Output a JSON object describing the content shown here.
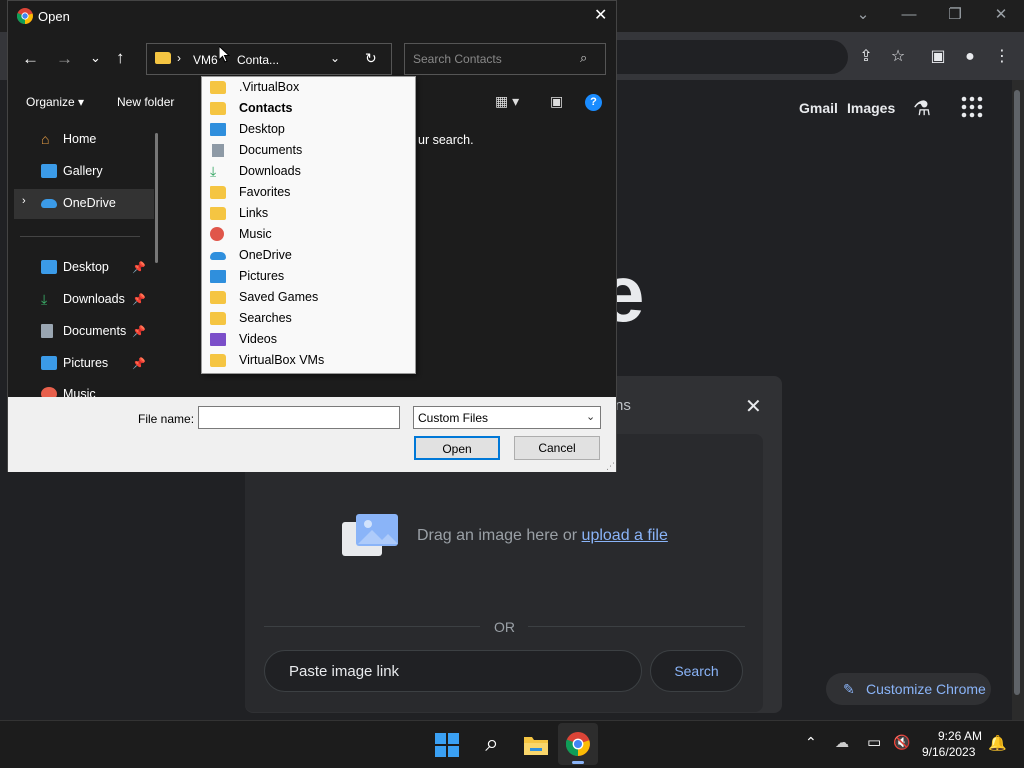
{
  "chrome": {
    "google_links": {
      "gmail": "Gmail",
      "images": "Images"
    },
    "logo_fragment": "e",
    "lens": {
      "title_fragment": "ns",
      "drop_text": "Drag an image here or",
      "upload_link": "upload a file",
      "or": "OR",
      "paste_placeholder": "Paste image link",
      "search_button": "Search"
    },
    "customize": "Customize Chrome"
  },
  "dialog": {
    "title": "Open",
    "address": {
      "root": "VM6",
      "current": "Conta..."
    },
    "search_placeholder": "Search Contacts",
    "commands": {
      "organize": "Organize",
      "new_folder": "New folder"
    },
    "empty_message_fragment": "ur search.",
    "nav": [
      {
        "label": "Home",
        "icon": "home-icon"
      },
      {
        "label": "Gallery",
        "icon": "gallery-icon"
      },
      {
        "label": "OneDrive",
        "icon": "onedrive-icon",
        "selected": true
      },
      {
        "label": "Desktop",
        "icon": "desktop-icon",
        "pinned": true
      },
      {
        "label": "Downloads",
        "icon": "downloads-icon",
        "pinned": true
      },
      {
        "label": "Documents",
        "icon": "documents-icon",
        "pinned": true
      },
      {
        "label": "Pictures",
        "icon": "pictures-icon",
        "pinned": true
      },
      {
        "label": "Music",
        "icon": "music-icon",
        "pinned": true
      }
    ],
    "file_name_label": "File name:",
    "file_name_value": "",
    "file_type": "Custom Files",
    "open_button": "Open",
    "cancel_button": "Cancel"
  },
  "dropdown": {
    "items": [
      {
        "label": ".VirtualBox",
        "icon": "folder-icon"
      },
      {
        "label": "Contacts",
        "icon": "folder-icon",
        "bold": true
      },
      {
        "label": "Desktop",
        "icon": "desktop-icon"
      },
      {
        "label": "Documents",
        "icon": "documents-icon"
      },
      {
        "label": "Downloads",
        "icon": "downloads-icon"
      },
      {
        "label": "Favorites",
        "icon": "folder-icon"
      },
      {
        "label": "Links",
        "icon": "folder-icon"
      },
      {
        "label": "Music",
        "icon": "music-icon"
      },
      {
        "label": "OneDrive",
        "icon": "onedrive-icon"
      },
      {
        "label": "Pictures",
        "icon": "pictures-icon"
      },
      {
        "label": "Saved Games",
        "icon": "folder-icon"
      },
      {
        "label": "Searches",
        "icon": "folder-icon"
      },
      {
        "label": "Videos",
        "icon": "videos-icon"
      },
      {
        "label": "VirtualBox VMs",
        "icon": "folder-icon"
      }
    ]
  },
  "taskbar": {
    "time": "9:26 AM",
    "date": "9/16/2023"
  },
  "colors": {
    "accent_link": "#8ab4f8",
    "dialog_dark": "#1c1c1c",
    "folder_yellow": "#f5c542",
    "focus_blue": "#0078d7"
  }
}
